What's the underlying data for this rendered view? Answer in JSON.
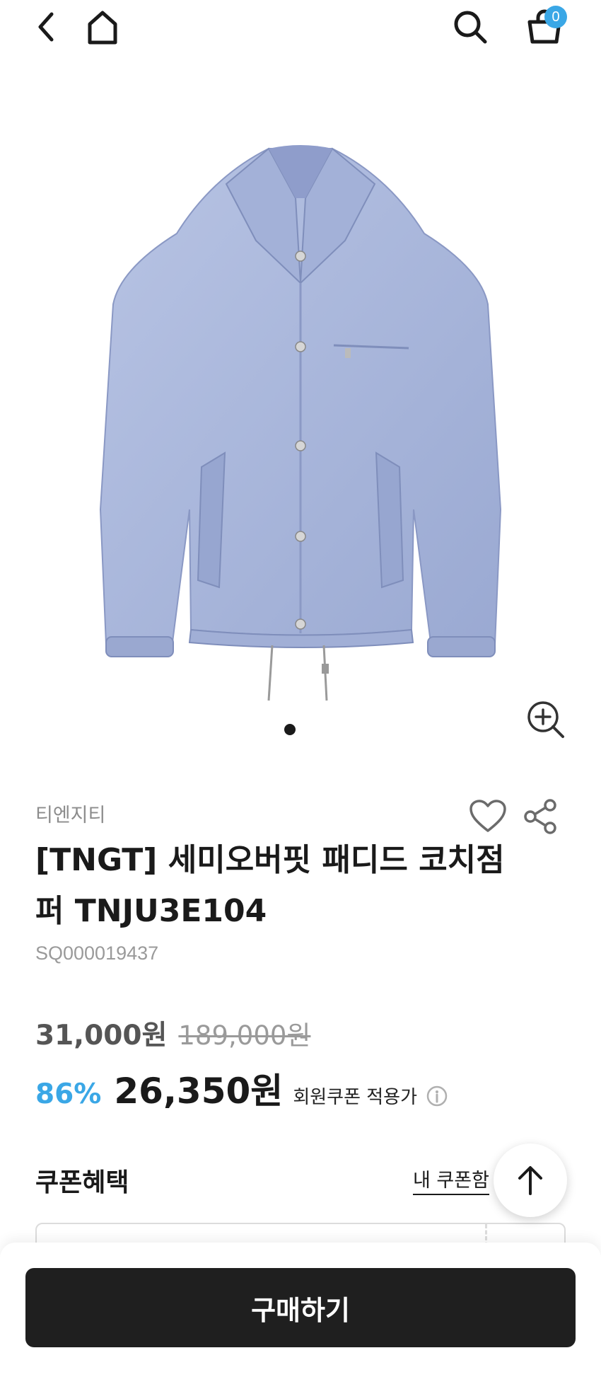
{
  "header": {
    "back_icon": "chevron-left-icon",
    "home_icon": "home-icon",
    "search_icon": "search-icon",
    "cart_icon": "shopping-bag-icon",
    "cart_count": "0"
  },
  "gallery": {
    "image": "light-blue-padded-coach-jacket",
    "zoom_icon": "zoom-in-icon"
  },
  "product": {
    "brand": "티엔지티",
    "title": "[TNGT] 세미오버핏 패디드 코치점퍼 TNJU3E104",
    "sku": "SQ000019437",
    "sale_price": "31,000원",
    "original_price": "189,000원",
    "discount": "86%",
    "final_price": "26,350원",
    "coupon_note": "회원쿠폰 적용가"
  },
  "coupon": {
    "heading": "쿠폰혜택",
    "my_coupon_link": "내 쿠폰함"
  },
  "actions": {
    "buy_label": "구매하기"
  },
  "colors": {
    "accent": "#3aa7e6",
    "buy_button": "#1f1f1f",
    "jacket": "#a9b7dc"
  }
}
